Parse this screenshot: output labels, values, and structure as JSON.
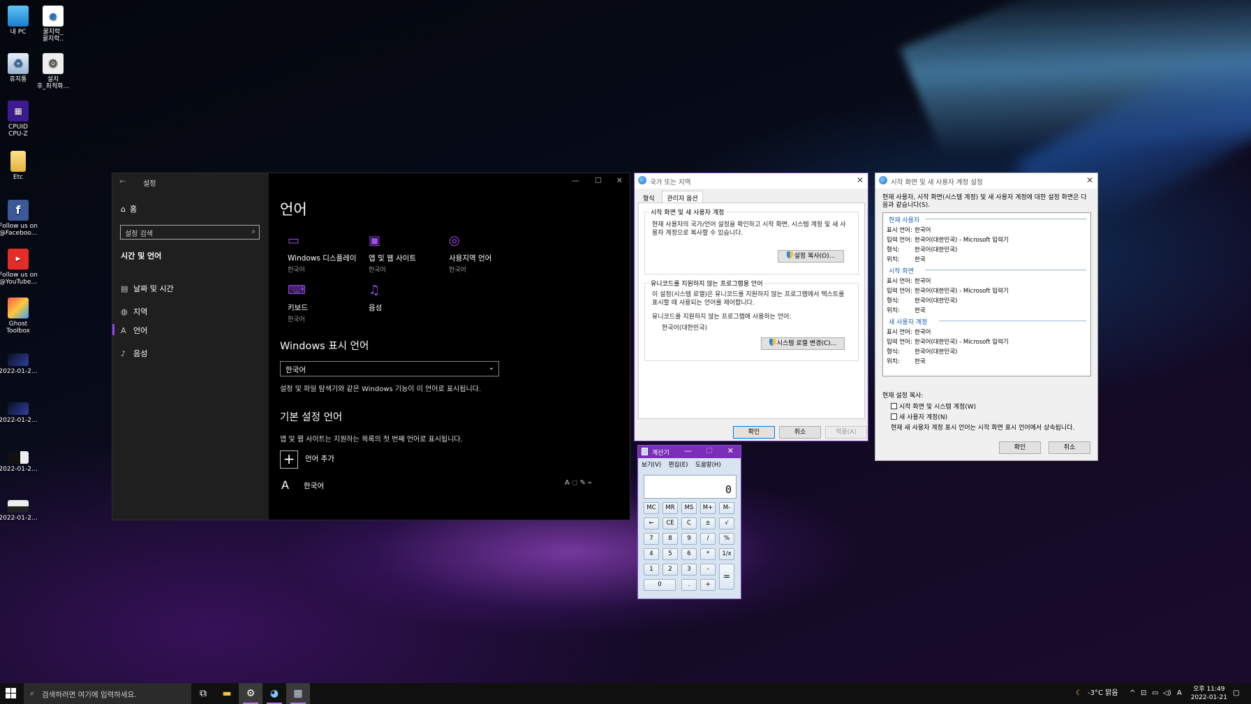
{
  "desktop": {
    "icons": [
      {
        "label": "내 PC",
        "icon": "monitor-icon"
      },
      {
        "label": "꿀지락_\n꿀지락..",
        "icon": "internet-explorer-icon"
      },
      {
        "label": "휴지통",
        "icon": "recycle-bin-icon"
      },
      {
        "label": "설치\n후_최적화...",
        "icon": "settings-shortcut-icon"
      },
      {
        "label": "CPUID\nCPU-Z",
        "icon": "cpu-z-icon"
      },
      {
        "label": "Etc",
        "icon": "folder-icon"
      },
      {
        "label": "Follow us on\n@Faceboo...",
        "icon": "facebook-icon"
      },
      {
        "label": "Follow us on\n@YouTube...",
        "icon": "youtube-icon"
      },
      {
        "label": "Ghost\nToolbox",
        "icon": "ghost-toolbox-icon"
      },
      {
        "label": "2022-01-2...",
        "icon": "screenshot-file-icon"
      },
      {
        "label": "2022-01-2...",
        "icon": "screenshot-file-icon"
      },
      {
        "label": "2022-01-2...",
        "icon": "screenshot-file-icon"
      },
      {
        "label": "2022-01-2...",
        "icon": "screenshot-file-icon"
      }
    ]
  },
  "settings": {
    "title": "설정",
    "back": "←",
    "home": "홈",
    "search_placeholder": "설정 검색",
    "section": "시간 및 언어",
    "nav": [
      {
        "label": "날짜 및 시간",
        "icon": "calendar-clock-icon"
      },
      {
        "label": "지역",
        "icon": "globe-icon"
      },
      {
        "label": "언어",
        "icon": "language-icon"
      },
      {
        "label": "음성",
        "icon": "microphone-icon"
      }
    ],
    "page_title": "언어",
    "tiles": [
      {
        "label": "Windows 디스플레이",
        "sub": "한국어",
        "icon": "laptop-icon"
      },
      {
        "label": "앱 및 웹 사이트",
        "sub": "한국어",
        "icon": "browser-window-icon"
      },
      {
        "label": "사용지역 언어",
        "sub": "한국어",
        "icon": "regional-globe-icon"
      },
      {
        "label": "키보드",
        "sub": "한국어",
        "icon": "keyboard-icon"
      },
      {
        "label": "음성",
        "sub": "",
        "icon": "microphone-icon"
      }
    ],
    "display_lang_heading": "Windows 표시 언어",
    "display_lang_value": "한국어",
    "display_lang_help": "설정 및 파일 탐색기와 같은 Windows 기능이 이 언어로 표시됩니다.",
    "pref_lang_heading": "기본 설정 언어",
    "pref_lang_help": "앱 및 웹 사이트는 지원하는 목록의 첫 번째 언어로 표시됩니다.",
    "add_language": "언어 추가",
    "languages": [
      {
        "label": "한국어"
      }
    ]
  },
  "region": {
    "title": "국가 또는 지역",
    "tabs": [
      "형식",
      "관리자 옵션"
    ],
    "group1_label": "시작 화면 및 새 사용자 계정",
    "group1_text": "현재 사용자의 국가/언어 설정을 확인하고 시작 화면, 시스템 계정 및 새 사용자 계정으로 복사할 수 있습니다.",
    "copy_button": "설정 복사(O)...",
    "group2_label": "유니코드를 지원하지 않는 프로그램용 언어",
    "group2_text": "이 설정(시스템 로캘)은 유니코드를 지원하지 않는 프로그램에서 텍스트를 표시할 때 사용되는 언어를 제어합니다.",
    "current_label": "유니코드를 지원하지 않는 프로그램에 사용하는 언어:",
    "current_value": "한국어(대한민국)",
    "locale_button": "시스템 로캘 변경(C)...",
    "ok": "확인",
    "cancel": "취소",
    "apply": "적용(A)"
  },
  "welcome": {
    "title": "시작 화면 및 새 사용자 계정 설정",
    "intro": "현재 사용자, 시작 화면(시스템 계정) 및 새 사용자 계정에 대한 설정 화면은 다음과 같습니다(S).",
    "sections": [
      {
        "name": "현재 사용자",
        "rows": [
          {
            "k": "표시 언어:",
            "v": "한국어"
          },
          {
            "k": "입력 언어:",
            "v": "한국어(대한민국) - Microsoft 입력기"
          },
          {
            "k": "형식:",
            "v": "한국어(대한민국)"
          },
          {
            "k": "위치:",
            "v": "한국"
          }
        ]
      },
      {
        "name": "시작 화면",
        "rows": [
          {
            "k": "표시 언어:",
            "v": "한국어"
          },
          {
            "k": "입력 언어:",
            "v": "한국어(대한민국) - Microsoft 입력기"
          },
          {
            "k": "형식:",
            "v": "한국어(대한민국)"
          },
          {
            "k": "위치:",
            "v": "한국"
          }
        ]
      },
      {
        "name": "새 사용자 계정",
        "rows": [
          {
            "k": "표시 언어:",
            "v": "한국어"
          },
          {
            "k": "입력 언어:",
            "v": "한국어(대한민국) - Microsoft 입력기"
          },
          {
            "k": "형식:",
            "v": "한국어(대한민국)"
          },
          {
            "k": "위치:",
            "v": "한국"
          }
        ]
      }
    ],
    "copy_label": "현재 설정 복사:",
    "check1": "시작 화면 및 시스템 계정(W)",
    "check2": "새 사용자 계정(N)",
    "note": "현재 새 사용자 계정 표시 언어는 시작 화면 표시 언어에서 상속됩니다.",
    "ok": "확인",
    "cancel": "취소"
  },
  "calc": {
    "title": "계산기",
    "menu": [
      "보기(V)",
      "편집(E)",
      "도움말(H)"
    ],
    "display": "0",
    "keys": [
      [
        "MC",
        "MR",
        "MS",
        "M+",
        "M-"
      ],
      [
        "←",
        "CE",
        "C",
        "±",
        "√"
      ],
      [
        "7",
        "8",
        "9",
        "/",
        "%"
      ],
      [
        "4",
        "5",
        "6",
        "*",
        "1/x"
      ],
      [
        "1",
        "2",
        "3",
        "-",
        "="
      ],
      [
        "0",
        ".",
        "+"
      ]
    ]
  },
  "taskbar": {
    "search_placeholder": "검색하려면 여기에 입력하세요.",
    "weather": "-3°C 맑음",
    "ime": "A",
    "time": "오후 11:49",
    "date": "2022-01-21"
  }
}
